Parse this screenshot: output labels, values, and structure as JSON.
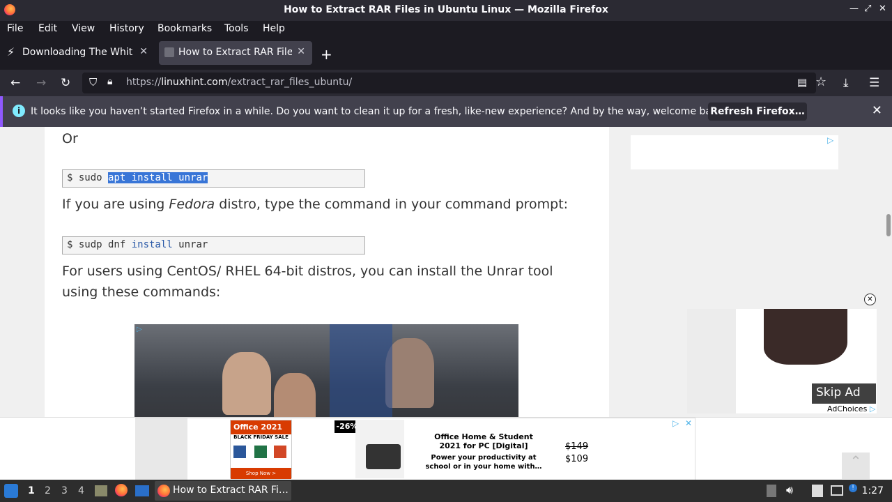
{
  "window": {
    "title": "How to Extract RAR Files in Ubuntu Linux — Mozilla Firefox"
  },
  "menu": [
    "File",
    "Edit",
    "View",
    "History",
    "Bookmarks",
    "Tools",
    "Help"
  ],
  "tabs": [
    {
      "label": "Downloading The White House",
      "active": false
    },
    {
      "label": "How to Extract RAR Files in Ubuntu",
      "active": true
    }
  ],
  "nav": {
    "url_prefix": "https://",
    "url_domain": "linuxhint.com",
    "url_path": "/extract_rar_files_ubuntu/"
  },
  "notification": {
    "message": "It looks like you haven’t started Firefox in a while. Do you want to clean it up for a fresh, like-new experience? And by the way, welcome back!",
    "button": "Refresh Firefox…"
  },
  "article": {
    "or": "Or",
    "code1_prefix": "$ sudo ",
    "code1_selected": "apt install unrar",
    "fedora_pre": "If you are using ",
    "fedora_em": "Fedora",
    "fedora_post": " distro, type the command in your command prompt:",
    "code2_prefix": "$ sudp dnf ",
    "code2_kw": "install",
    "code2_suffix": " unrar",
    "centos": "For users using CentOS/ RHEL 64-bit distros, you can install the Unrar tool using these commands:"
  },
  "video_ad": {
    "skip": "Skip Ad",
    "adchoices": "AdChoices"
  },
  "banner_ad": {
    "brand": "Office 2021",
    "sale": "BLACK FRIDAY SALE",
    "discount": "-26%",
    "product_title": "Office Home & Student 2021 for PC [Digital]",
    "product_desc": "Power your productivity at school or in your home with…",
    "old_price": "$149",
    "new_price": "$109",
    "shop": "Shop Now >"
  },
  "taskbar": {
    "workspaces": [
      "1",
      "2",
      "3",
      "4"
    ],
    "window_label": "How to Extract RAR Fi…",
    "clock": "1:27"
  }
}
